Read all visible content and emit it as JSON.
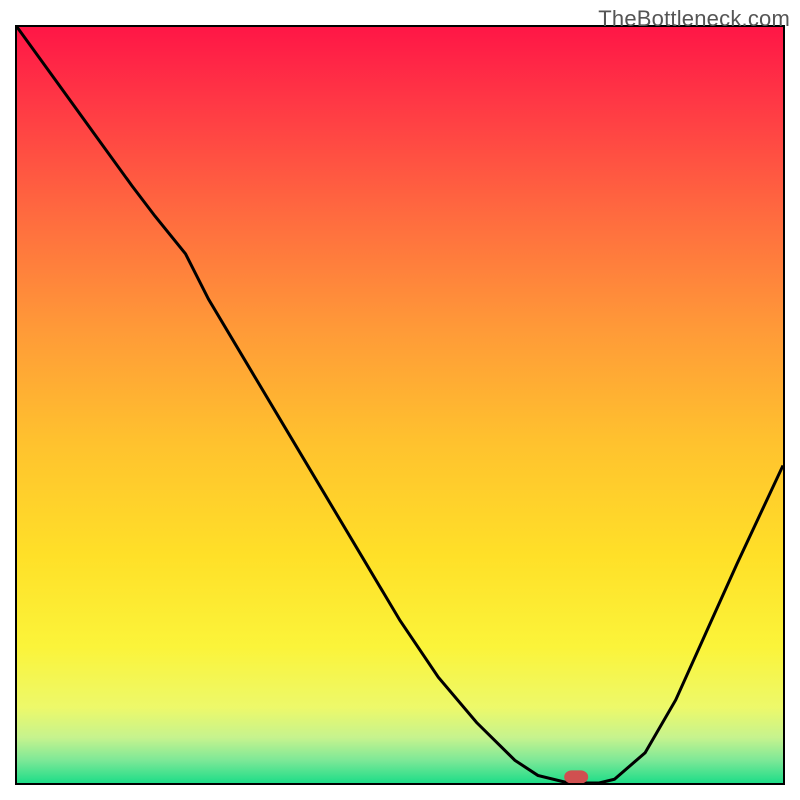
{
  "watermark": "TheBottleneck.com",
  "chart_data": {
    "type": "line",
    "title": "",
    "xlabel": "",
    "ylabel": "",
    "x_range": [
      0,
      100
    ],
    "y_range": [
      0,
      100
    ],
    "x": [
      0,
      5,
      10,
      15,
      18,
      22,
      25,
      30,
      35,
      40,
      45,
      50,
      55,
      60,
      65,
      68,
      72,
      76,
      78,
      82,
      86,
      90,
      94,
      100
    ],
    "y": [
      100,
      93,
      86,
      79,
      75,
      70,
      64,
      55.5,
      47,
      38.5,
      30,
      21.5,
      14,
      8,
      3,
      1,
      0,
      0,
      0.5,
      4,
      11,
      20,
      29,
      42
    ],
    "marker": {
      "x": 73,
      "y": 0,
      "w": 3,
      "h": 1.6
    },
    "description": "V-shaped bottleneck curve over red-to-green vertical gradient; minimum near x≈73"
  }
}
